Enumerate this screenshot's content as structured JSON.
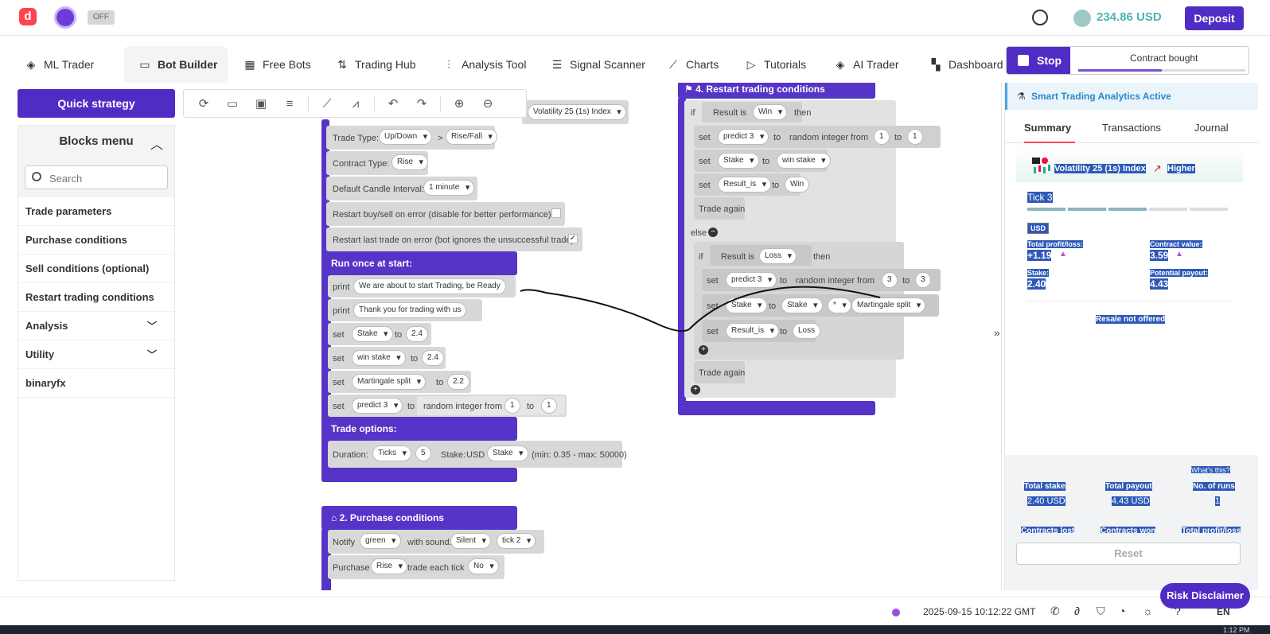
{
  "header": {
    "toggle_label": "OFF",
    "balance": "234.86 USD",
    "deposit_label": "Deposit"
  },
  "nav": {
    "tabs": [
      {
        "label": "ML Trader",
        "icon": "layers-icon"
      },
      {
        "label": "Bot Builder",
        "icon": "builder-icon"
      },
      {
        "label": "Free Bots",
        "icon": "grid-icon"
      },
      {
        "label": "Trading Hub",
        "icon": "swap-icon"
      },
      {
        "label": "Analysis Tool",
        "icon": "sliders-icon"
      },
      {
        "label": "Signal Scanner",
        "icon": "list-icon"
      },
      {
        "label": "Charts",
        "icon": "chart-icon"
      },
      {
        "label": "Tutorials",
        "icon": "play-icon"
      },
      {
        "label": "AI Trader",
        "icon": "layers-icon"
      },
      {
        "label": "Dashboard",
        "icon": "dashboard-icon"
      }
    ]
  },
  "run_panel": {
    "stop_label": "Stop",
    "status": "Contract bought",
    "progress": 0.5
  },
  "sidebar": {
    "quick_strategy": "Quick strategy",
    "blocks_menu": "Blocks menu",
    "search_placeholder": "Search",
    "items": [
      {
        "label": "Trade parameters"
      },
      {
        "label": "Purchase conditions"
      },
      {
        "label": "Sell conditions (optional)"
      },
      {
        "label": "Restart trading conditions"
      },
      {
        "label": "Analysis",
        "expandable": true
      },
      {
        "label": "Utility",
        "expandable": true
      },
      {
        "label": "binaryfx"
      }
    ]
  },
  "blocks": {
    "market": "Volatility 25 (1s) Index",
    "trade_type_label": "Trade Type:",
    "trade_type_1": "Up/Down",
    "trade_type_sep": ">",
    "trade_type_2": "Rise/Fall",
    "contract_type_label": "Contract Type:",
    "contract_type": "Rise",
    "candle_label": "Default Candle Interval:",
    "candle_value": "1 minute",
    "restart_buy_label": "Restart buy/sell on error (disable for better performance):",
    "restart_last_label": "Restart last trade on error (bot ignores the unsuccessful trade):",
    "restart_last_check": "✓",
    "run_once_header": "Run once at start:",
    "print_kw": "print",
    "set_kw": "set",
    "to_kw": "to",
    "print_1": "We are about to start Trading, be Ready",
    "print_2": "Thank you for trading with us",
    "stake_var": "Stake",
    "stake_val": "2.4",
    "winstake_var": "win stake",
    "winstake_val": "2.4",
    "martingale_var": "Martingale split",
    "martingale_val": "2.2",
    "predict_var": "predict 3",
    "random_label": "random integer from",
    "rand_from": "1",
    "rand_to": "1",
    "trade_options_header": "Trade options:",
    "duration_label": "Duration:",
    "duration_unit": "Ticks",
    "duration_val": "5",
    "stake_label": "Stake:",
    "currency": "USD",
    "stake_select": "Stake",
    "stake_range": "(min: 0.35 - max: 50000)",
    "purchase_header": "2. Purchase conditions",
    "notify_label": "Notify",
    "notify_color": "green",
    "with_sound_label": "with sound:",
    "sound": "Silent",
    "tick_sound": "tick 2",
    "purchase_label": "Purchase",
    "purchase_type": "Rise",
    "trade_each_tick": "trade each tick",
    "each_tick_val": "No",
    "restart_header": "4. Restart trading conditions",
    "if_kw": "if",
    "result_is": "Result is",
    "win": "Win",
    "loss": "Loss",
    "then_kw": "then",
    "else_kw": "else",
    "rand_3_from": "3",
    "rand_3_to": "3",
    "result_is_var": "Result_is",
    "win_text": "Win",
    "loss_text": "Loss",
    "trade_again": "Trade again",
    "multiply_op": "*"
  },
  "summary": {
    "smart_label": "Smart Trading Analytics Active",
    "tabs": [
      "Summary",
      "Transactions",
      "Journal"
    ],
    "symbol": "Volatility 25 (1s) Index",
    "direction": "Higher",
    "tick": "Tick 3",
    "ticks_done": 3,
    "ticks_total": 5,
    "currency": "USD",
    "total_pl_label": "Total profit/loss:",
    "total_pl": "+1.19",
    "contract_value_label": "Contract value:",
    "contract_value": "3.59",
    "stake_label": "Stake:",
    "stake": "2.40",
    "payout_label": "Potential payout:",
    "payout": "4.43",
    "resale": "Resale not offered",
    "whats_this": "What's this?",
    "stats": [
      {
        "label": "Total stake",
        "value": "2.40 USD"
      },
      {
        "label": "Total payout",
        "value": "4.43 USD"
      },
      {
        "label": "No. of runs",
        "value": "1"
      }
    ],
    "stats_row2": [
      "Contracts lost",
      "Contracts won",
      "Total profit/loss"
    ],
    "reset_label": "Reset"
  },
  "footer": {
    "timestamp": "2025-09-15 10:12:22 GMT",
    "language": "EN",
    "risk_label": "Risk Disclaimer",
    "clock": "1:12 PM"
  }
}
